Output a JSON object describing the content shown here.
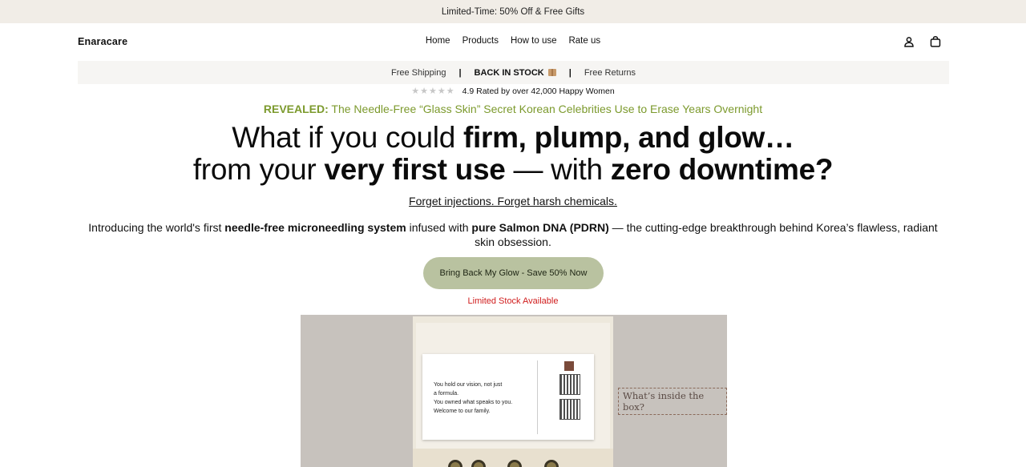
{
  "announcement": "Limited-Time: 50% Off & Free Gifts",
  "header": {
    "logo": "Enaracare",
    "nav": [
      "Home",
      "Products",
      "How to use",
      "Rate us"
    ]
  },
  "trust_bar": {
    "item1": "Free Shipping",
    "item2": "BACK IN STOCK",
    "item3": "Free Returns"
  },
  "rating": {
    "stars": "★★★★★",
    "text": "4.9 Rated by over 42,000 Happy Women"
  },
  "revealed": {
    "label": "REVEALED:",
    "text": " The Needle-Free “Glass Skin” Secret Korean Celebrities Use to Erase Years Overnight"
  },
  "headline": {
    "l1_a": "What if you could ",
    "l1_b": "firm, plump, and glow…",
    "l2_a": "from your ",
    "l2_b": "very first use",
    "l2_c": " — with ",
    "l2_d": "zero downtime?"
  },
  "forget": "Forget injections. Forget harsh chemicals.",
  "intro": {
    "a": "Introducing the world's first ",
    "b": "needle-free microneedling system",
    "c": " infused with ",
    "d": "pure Salmon DNA (PDRN)",
    "e": " — the cutting-edge breakthrough behind Korea’s flawless, radiant skin obsession."
  },
  "cta": "Bring Back My Glow - Save 50% Now",
  "limited": "Limited Stock Available",
  "product": {
    "card_l1": "You hold our vision, not just",
    "card_l2": "a formula.",
    "card_l3": "You owned what speaks to you.",
    "card_l4": "Welcome to our family.",
    "whats_inside": "What’s inside the box?"
  },
  "colors": {
    "announce_bg": "#f1ede7",
    "accent_green": "#7c9a2d",
    "cta_bg": "#b9c2a0",
    "alert_red": "#d01c1c"
  }
}
